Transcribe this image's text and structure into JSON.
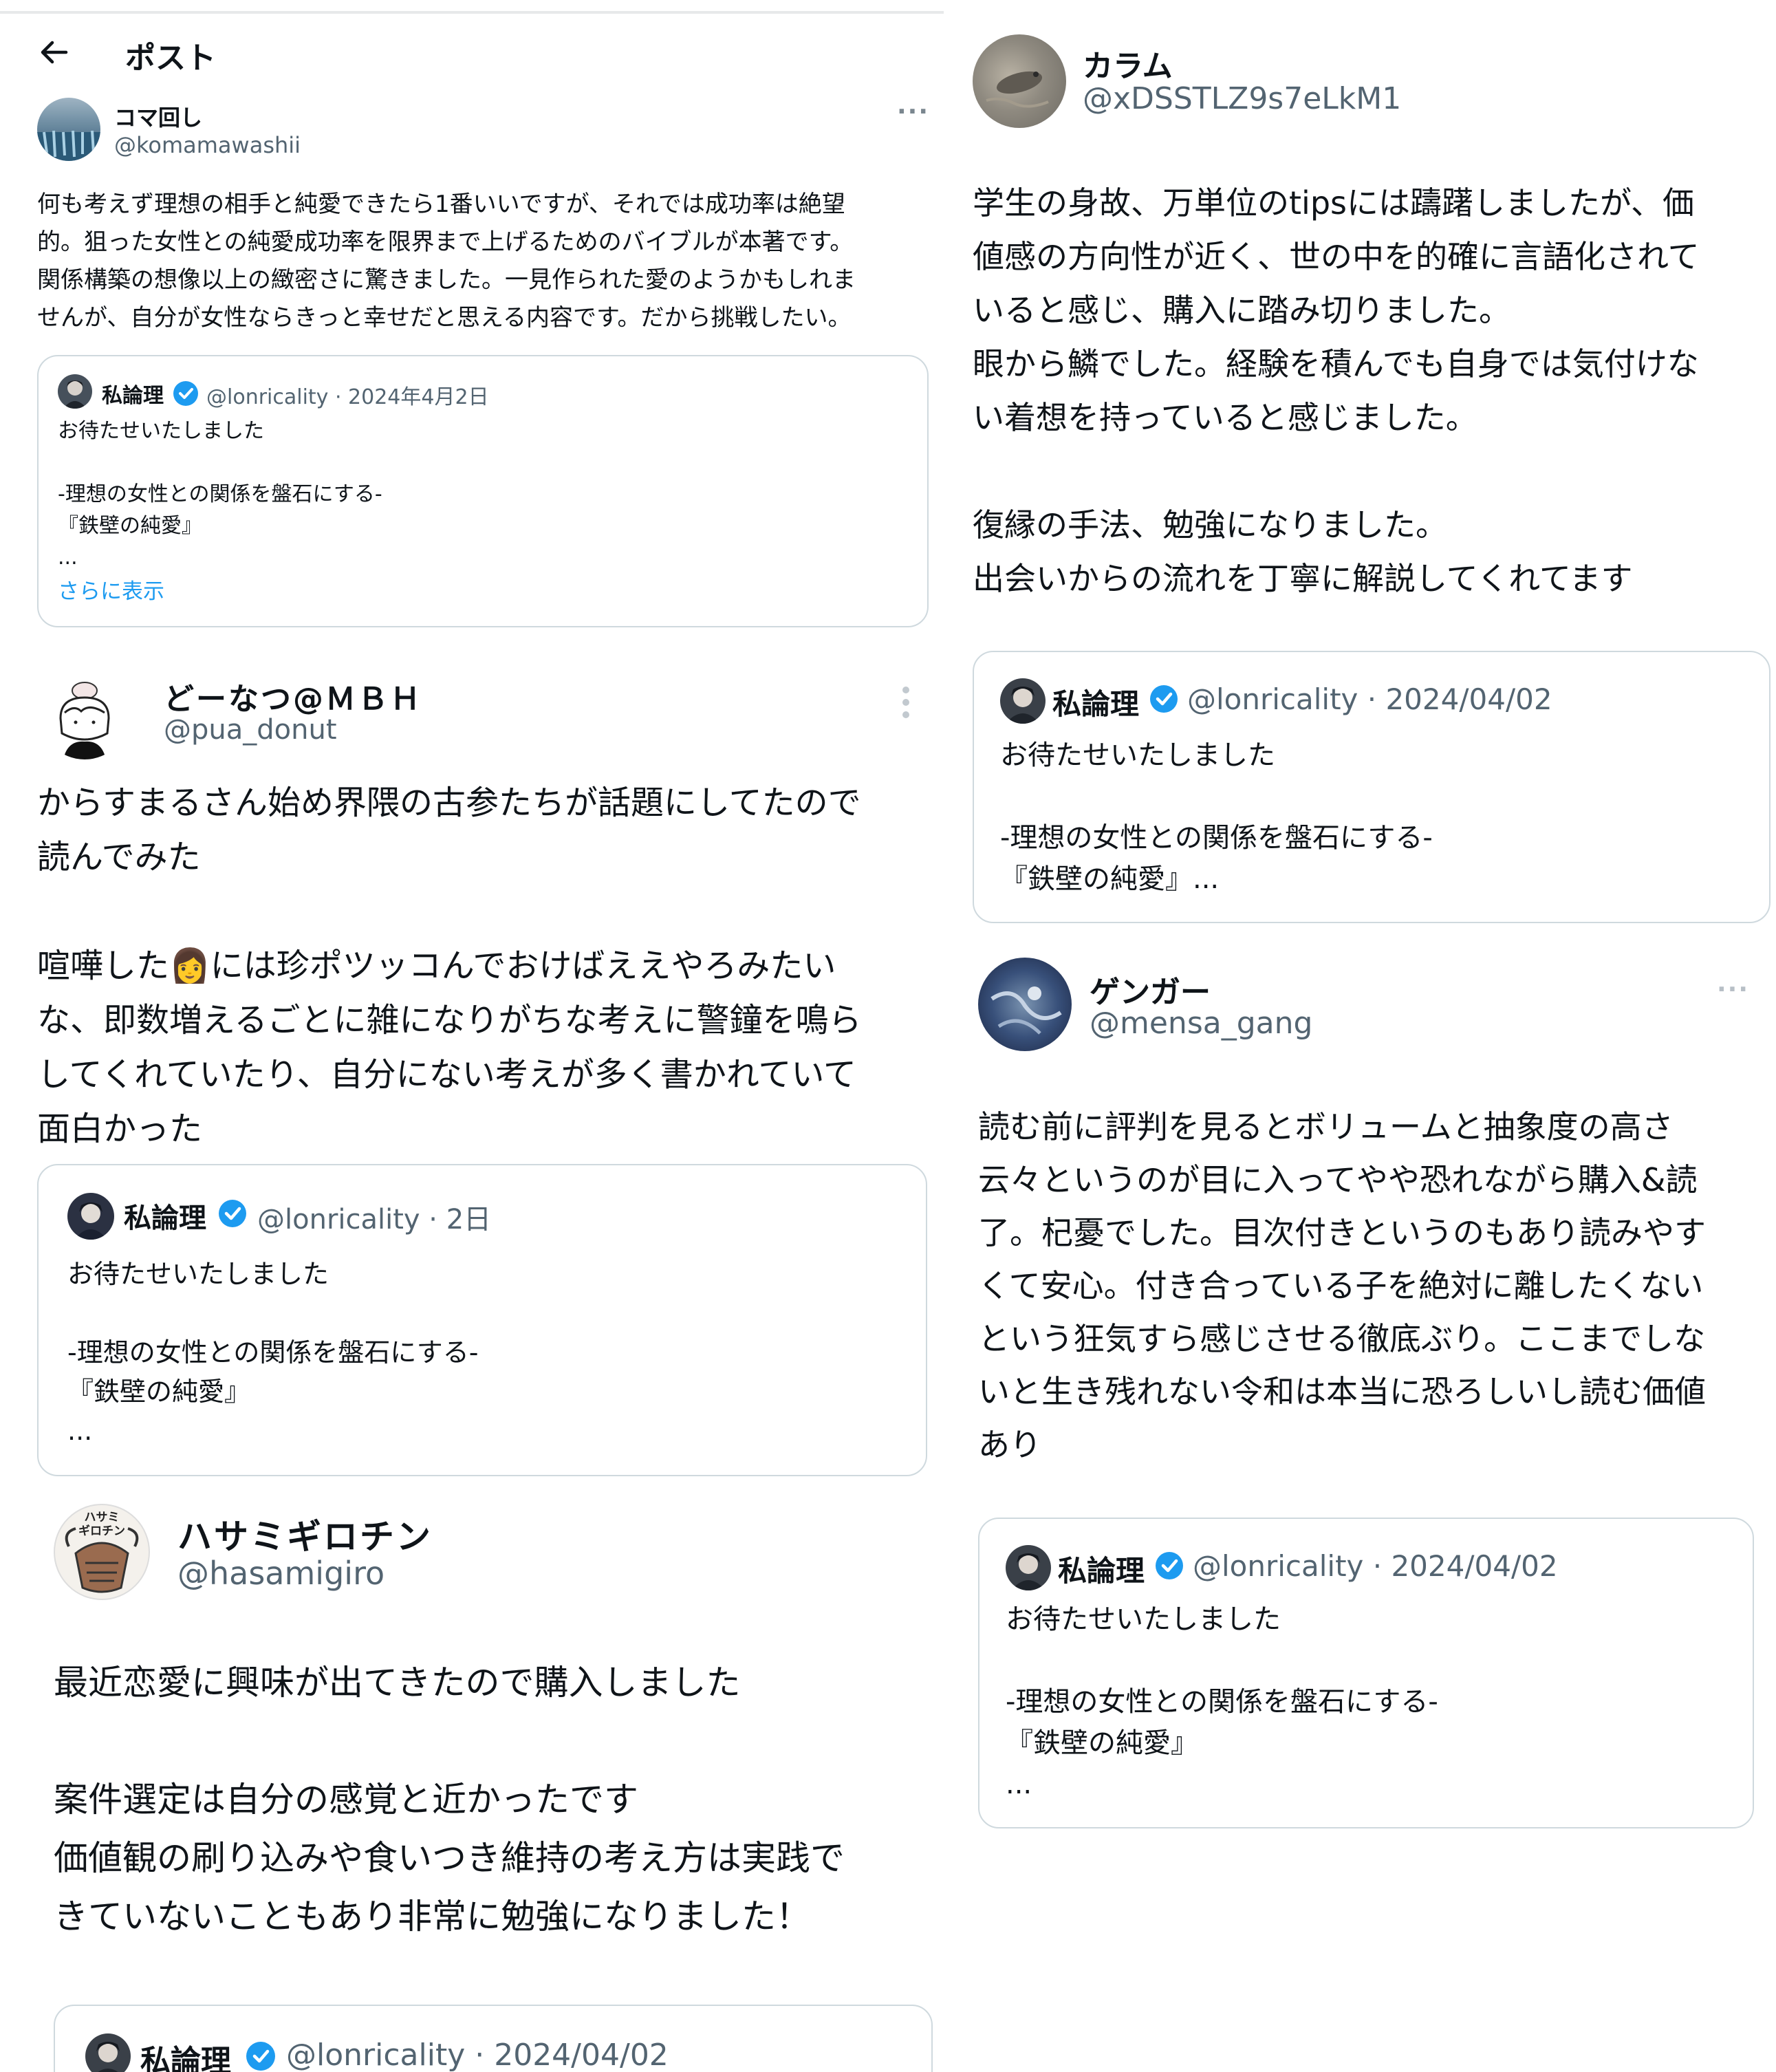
{
  "header": {
    "back_icon": "arrow-left-icon",
    "title": "ポスト"
  },
  "posts": [
    {
      "name": "コマ回し",
      "handle": "@komamawashii",
      "text": "何も考えず理想の相手と純愛できたら1番いいですが、それでは成功率は絶望\n的。狙った女性との純愛成功率を限界まで上げるためのバイブルが本著です。\n関係構築の想像以上の緻密さに驚きました。一見作られた愛のようかもしれま\nせんが、自分が女性ならきっと幸せだと思える内容です。だから挑戦したい。",
      "more": "···",
      "quote": {
        "name": "私論理",
        "meta": "@lonricality · 2024年4月2日",
        "text": "お待たせいたしました\n\n-理想の女性との関係を盤石にする-\n『鉄壁の純愛』\n...",
        "show_more": "さらに表示"
      }
    },
    {
      "name": "どーなつ@ＭＢＨ",
      "handle": "@pua_donut",
      "text_a": "からすまるさん始め界隈の古参たちが話題にしてたので\n読んでみた\n\n喧嘩した",
      "emoji": "👩",
      "text_b": "には珍ポツッコんでおけばええやろみたい\nな、即数増えるごとに雑になりがちな考えに警鐘を鳴ら\nしてくれていたり、自分にない考えが多く書かれていて\n面白かった",
      "quote": {
        "name": "私論理",
        "meta": "@lonricality · 2日",
        "text": "お待たせいたしました\n\n-理想の女性との関係を盤石にする-\n『鉄壁の純愛』\n..."
      }
    },
    {
      "name": "ハサミギロチン",
      "handle": "@hasamigiro",
      "avatar_text": "ハサミ\nギロチン",
      "text": "最近恋愛に興味が出てきたので購入しました\n\n案件選定は自分の感覚と近かったです\n価値観の刷り込みや食いつき維持の考え方は実践で\nきていないこともあり非常に勉強になりました！",
      "quote": {
        "name": "私論理",
        "meta": "@lonricality · 2024/04/02"
      }
    },
    {
      "name": "カラム",
      "handle": "@xDSSTLZ9s7eLkM1",
      "text": "学生の身故、万単位のtipsには躊躇しましたが、価\n値感の方向性が近く、世の中を的確に言語化されて\nいると感じ、購入に踏み切りました。\n眼から鱗でした。経験を積んでも自身では気付けな\nい着想を持っていると感じました。\n\n復縁の手法、勉強になりました。\n出会いからの流れを丁寧に解説してくれてます",
      "quote": {
        "name": "私論理",
        "meta": "@lonricality · 2024/04/02",
        "text": "お待たせいたしました\n\n-理想の女性との関係を盤石にする-\n『鉄壁の純愛』..."
      }
    },
    {
      "name": "ゲンガー",
      "handle": "@mensa_gang",
      "more": "···",
      "text": "読む前に評判を見るとボリュームと抽象度の高さ\n云々というのが目に入ってやや恐れながら購入&読\n了。杞憂でした。目次付きというのもあり読みやす\nくて安心。付き合っている子を絶対に離したくない\nという狂気すら感じさせる徹底ぶり。ここまでしな\nいと生き残れない令和は本当に恐ろしいし読む価値\nあり",
      "quote": {
        "name": "私論理",
        "meta": "@lonricality · 2024/04/02",
        "text": "お待たせいたしました\n\n-理想の女性との関係を盤石にする-\n『鉄壁の純愛』\n..."
      }
    }
  ],
  "colors": {
    "text": "#0f1419",
    "secondary": "#536471",
    "verified": "#1d9bf0",
    "border": "#cfd9de"
  }
}
